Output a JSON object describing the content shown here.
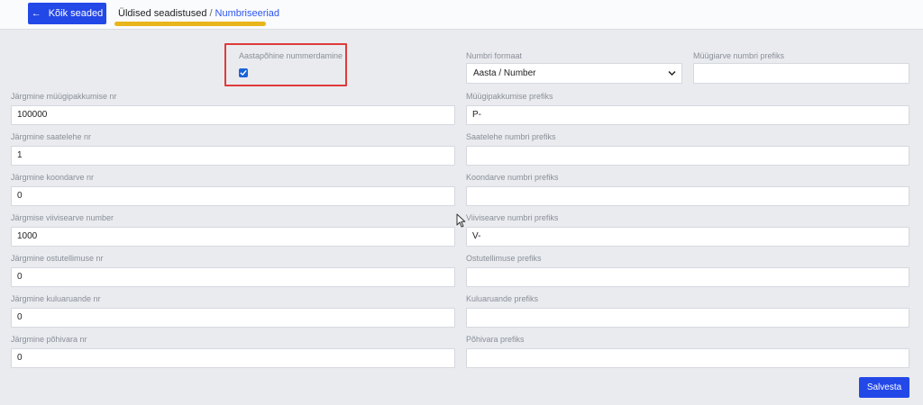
{
  "header": {
    "back_button": "Kõik seaded",
    "breadcrumb_parent": "Üldised seadistused",
    "breadcrumb_separator": "/",
    "breadcrumb_current": "Numbriseeriad",
    "highlight_color": "#e9b51c"
  },
  "form": {
    "yearly_numbering": {
      "label": "Aastapõhine nummerdamine",
      "checked": true
    },
    "number_format": {
      "label": "Numbri formaat",
      "value": "Aasta / Number"
    },
    "sales_invoice_prefix": {
      "label": "Müügiarve numbri prefiks",
      "value": ""
    },
    "left": [
      {
        "label": "Järgmine müügipakkumise nr",
        "value": "100000"
      },
      {
        "label": "Järgmine saatelehe nr",
        "value": "1"
      },
      {
        "label": "Järgmine koondarve nr",
        "value": "0"
      },
      {
        "label": "Järgmise viivisearve number",
        "value": "1000"
      },
      {
        "label": "Järgmine ostutellimuse nr",
        "value": "0"
      },
      {
        "label": "Järgmine kuluaruande nr",
        "value": "0"
      },
      {
        "label": "Järgmine põhivara nr",
        "value": "0"
      }
    ],
    "right": [
      {
        "label": "Müügipakkumise prefiks",
        "value": "P-"
      },
      {
        "label": "Saatelehe numbri prefiks",
        "value": ""
      },
      {
        "label": "Koondarve numbri prefiks",
        "value": ""
      },
      {
        "label": "Viivisearve numbri prefiks",
        "value": "V-"
      },
      {
        "label": "Ostutellimuse prefiks",
        "value": ""
      },
      {
        "label": "Kuluaruande prefiks",
        "value": ""
      },
      {
        "label": "Põhivara prefiks",
        "value": ""
      }
    ],
    "save_button": "Salvesta"
  },
  "colors": {
    "accent": "#2348e8",
    "checkbox": "#1a63d8",
    "highlight_box": "#e03a3a"
  }
}
